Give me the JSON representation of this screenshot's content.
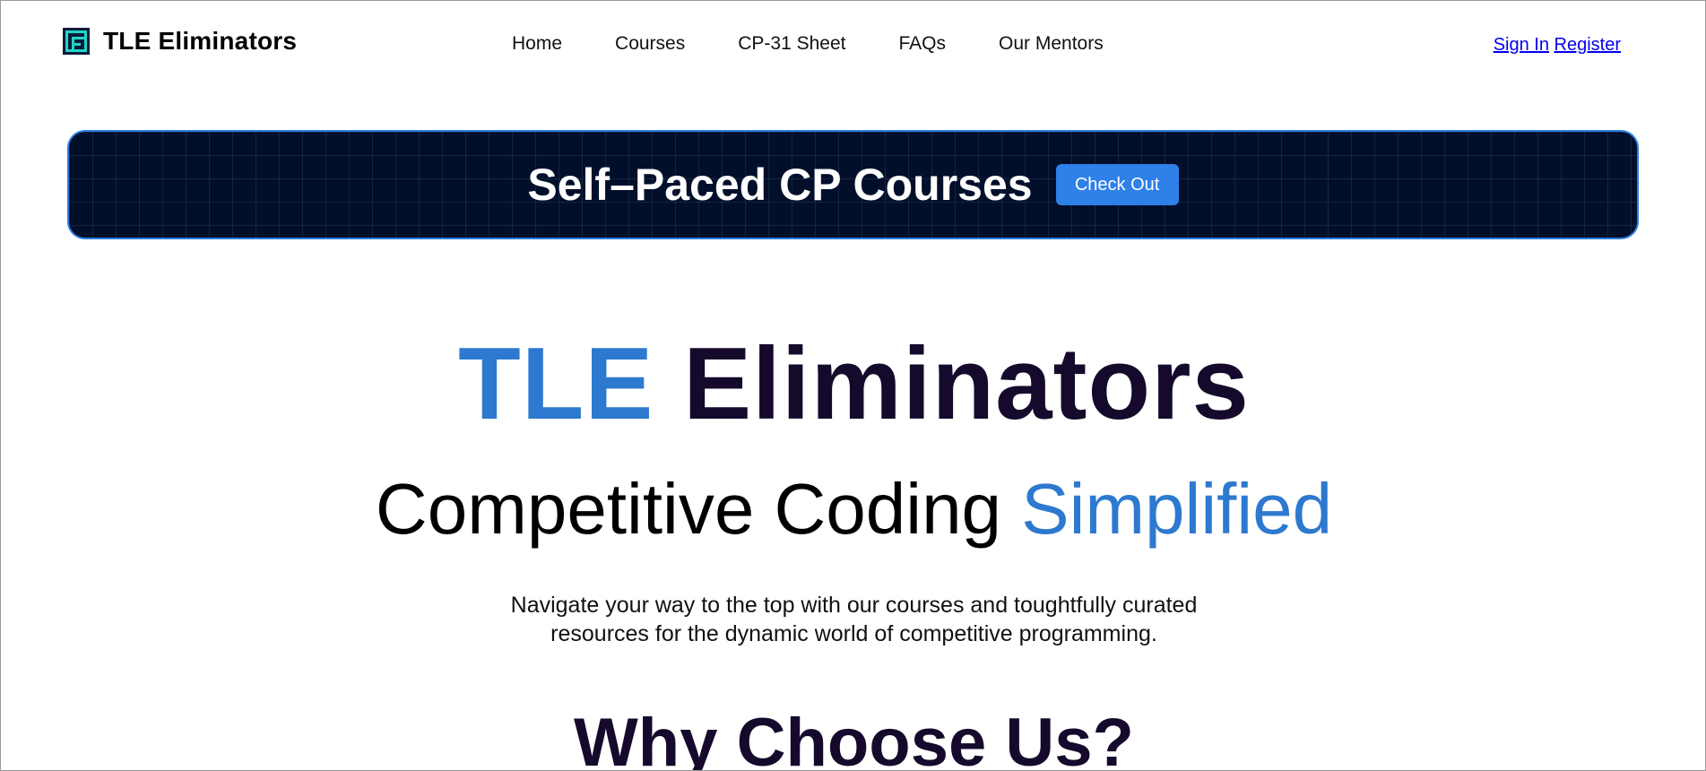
{
  "navbar": {
    "brand": "TLE Eliminators",
    "links": [
      "Home",
      "Courses",
      "CP-31 Sheet",
      "FAQs",
      "Our Mentors"
    ],
    "sign_in": "Sign In",
    "register": "Register"
  },
  "banner": {
    "title": "Self–Paced CP Courses",
    "button": "Check Out"
  },
  "hero": {
    "title_part1": "TLE",
    "title_part2": "Eliminators",
    "subtitle_part1": "Competitive Coding",
    "subtitle_part2": "Simplified",
    "description_line1": "Navigate your way to the top with our courses and toughtfully curated",
    "description_line2": "resources for the dynamic world of competitive programming."
  },
  "section": {
    "title": "Why Choose Us?"
  },
  "colors": {
    "accent_blue": "#2d79cf",
    "dark_heading": "#150a2c",
    "banner_bg": "#020f2a",
    "button_blue": "#2f80e8",
    "logo_teal": "#1fd6c8"
  },
  "icons": {
    "logo": "tle-logo-icon"
  }
}
